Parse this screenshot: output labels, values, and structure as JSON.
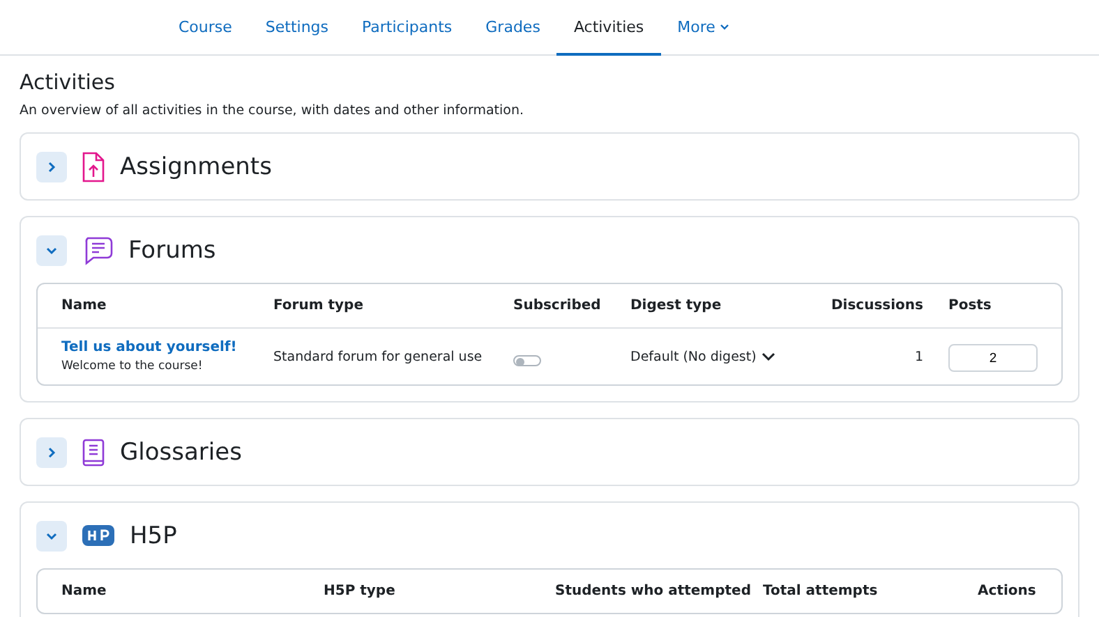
{
  "nav": [
    {
      "label": "Course",
      "selected": false
    },
    {
      "label": "Settings",
      "selected": false
    },
    {
      "label": "Participants",
      "selected": false
    },
    {
      "label": "Grades",
      "selected": false
    },
    {
      "label": "Activities",
      "selected": true
    },
    {
      "label": "More",
      "selected": false,
      "dropdown": true
    }
  ],
  "page": {
    "title": "Activities",
    "description": "An overview of all activities in the course, with dates and other information."
  },
  "sections": [
    {
      "kind": "assignment",
      "title": "Assignments",
      "expanded": false
    },
    {
      "kind": "forum",
      "title": "Forums",
      "expanded": true,
      "table": {
        "columns": [
          "Name",
          "Forum type",
          "Subscribed",
          "Digest type",
          "Discussions",
          "Posts"
        ],
        "rows": [
          {
            "name": "Tell us about yourself!",
            "intro": "Welcome to the course!",
            "forum_type": "Standard forum for general use",
            "subscribed": false,
            "digest": "Default (No digest)",
            "discussions": "1",
            "posts": "2"
          }
        ]
      }
    },
    {
      "kind": "glossary",
      "title": "Glossaries",
      "expanded": false
    },
    {
      "kind": "h5p",
      "title": "H5P",
      "expanded": true,
      "table": {
        "columns": [
          "Name",
          "H5P type",
          "Students who attempted",
          "Total attempts",
          "Actions"
        ]
      }
    }
  ]
}
